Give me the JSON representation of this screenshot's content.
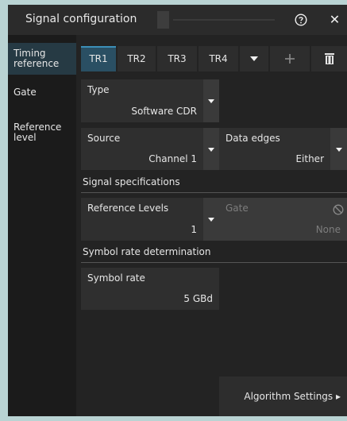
{
  "dialog": {
    "title": "Signal configuration"
  },
  "sidebar": {
    "items": [
      {
        "label": "Timing reference"
      },
      {
        "label": "Gate"
      },
      {
        "label": "Reference level"
      }
    ]
  },
  "tabs": [
    {
      "label": "TR1"
    },
    {
      "label": "TR2"
    },
    {
      "label": "TR3"
    },
    {
      "label": "TR4"
    }
  ],
  "type_field": {
    "label": "Type",
    "value": "Software CDR"
  },
  "source_field": {
    "label": "Source",
    "value": "Channel 1"
  },
  "data_edges_field": {
    "label": "Data edges",
    "value": "Either"
  },
  "signal_spec": {
    "heading": "Signal specifications"
  },
  "reference_levels_field": {
    "label": "Reference Levels",
    "value": "1"
  },
  "gate_field": {
    "label": "Gate",
    "value": "None"
  },
  "symbol_rate_section": {
    "heading": "Symbol rate determination"
  },
  "symbol_rate_field": {
    "label": "Symbol rate",
    "value": "5 GBd"
  },
  "footer": {
    "algorithm_settings_label": "Algorithm Settings ▸"
  },
  "colors": {
    "accent_tab": "#2a4f63",
    "accent_border": "#3c8fb8",
    "background": "#b9d3d3"
  }
}
